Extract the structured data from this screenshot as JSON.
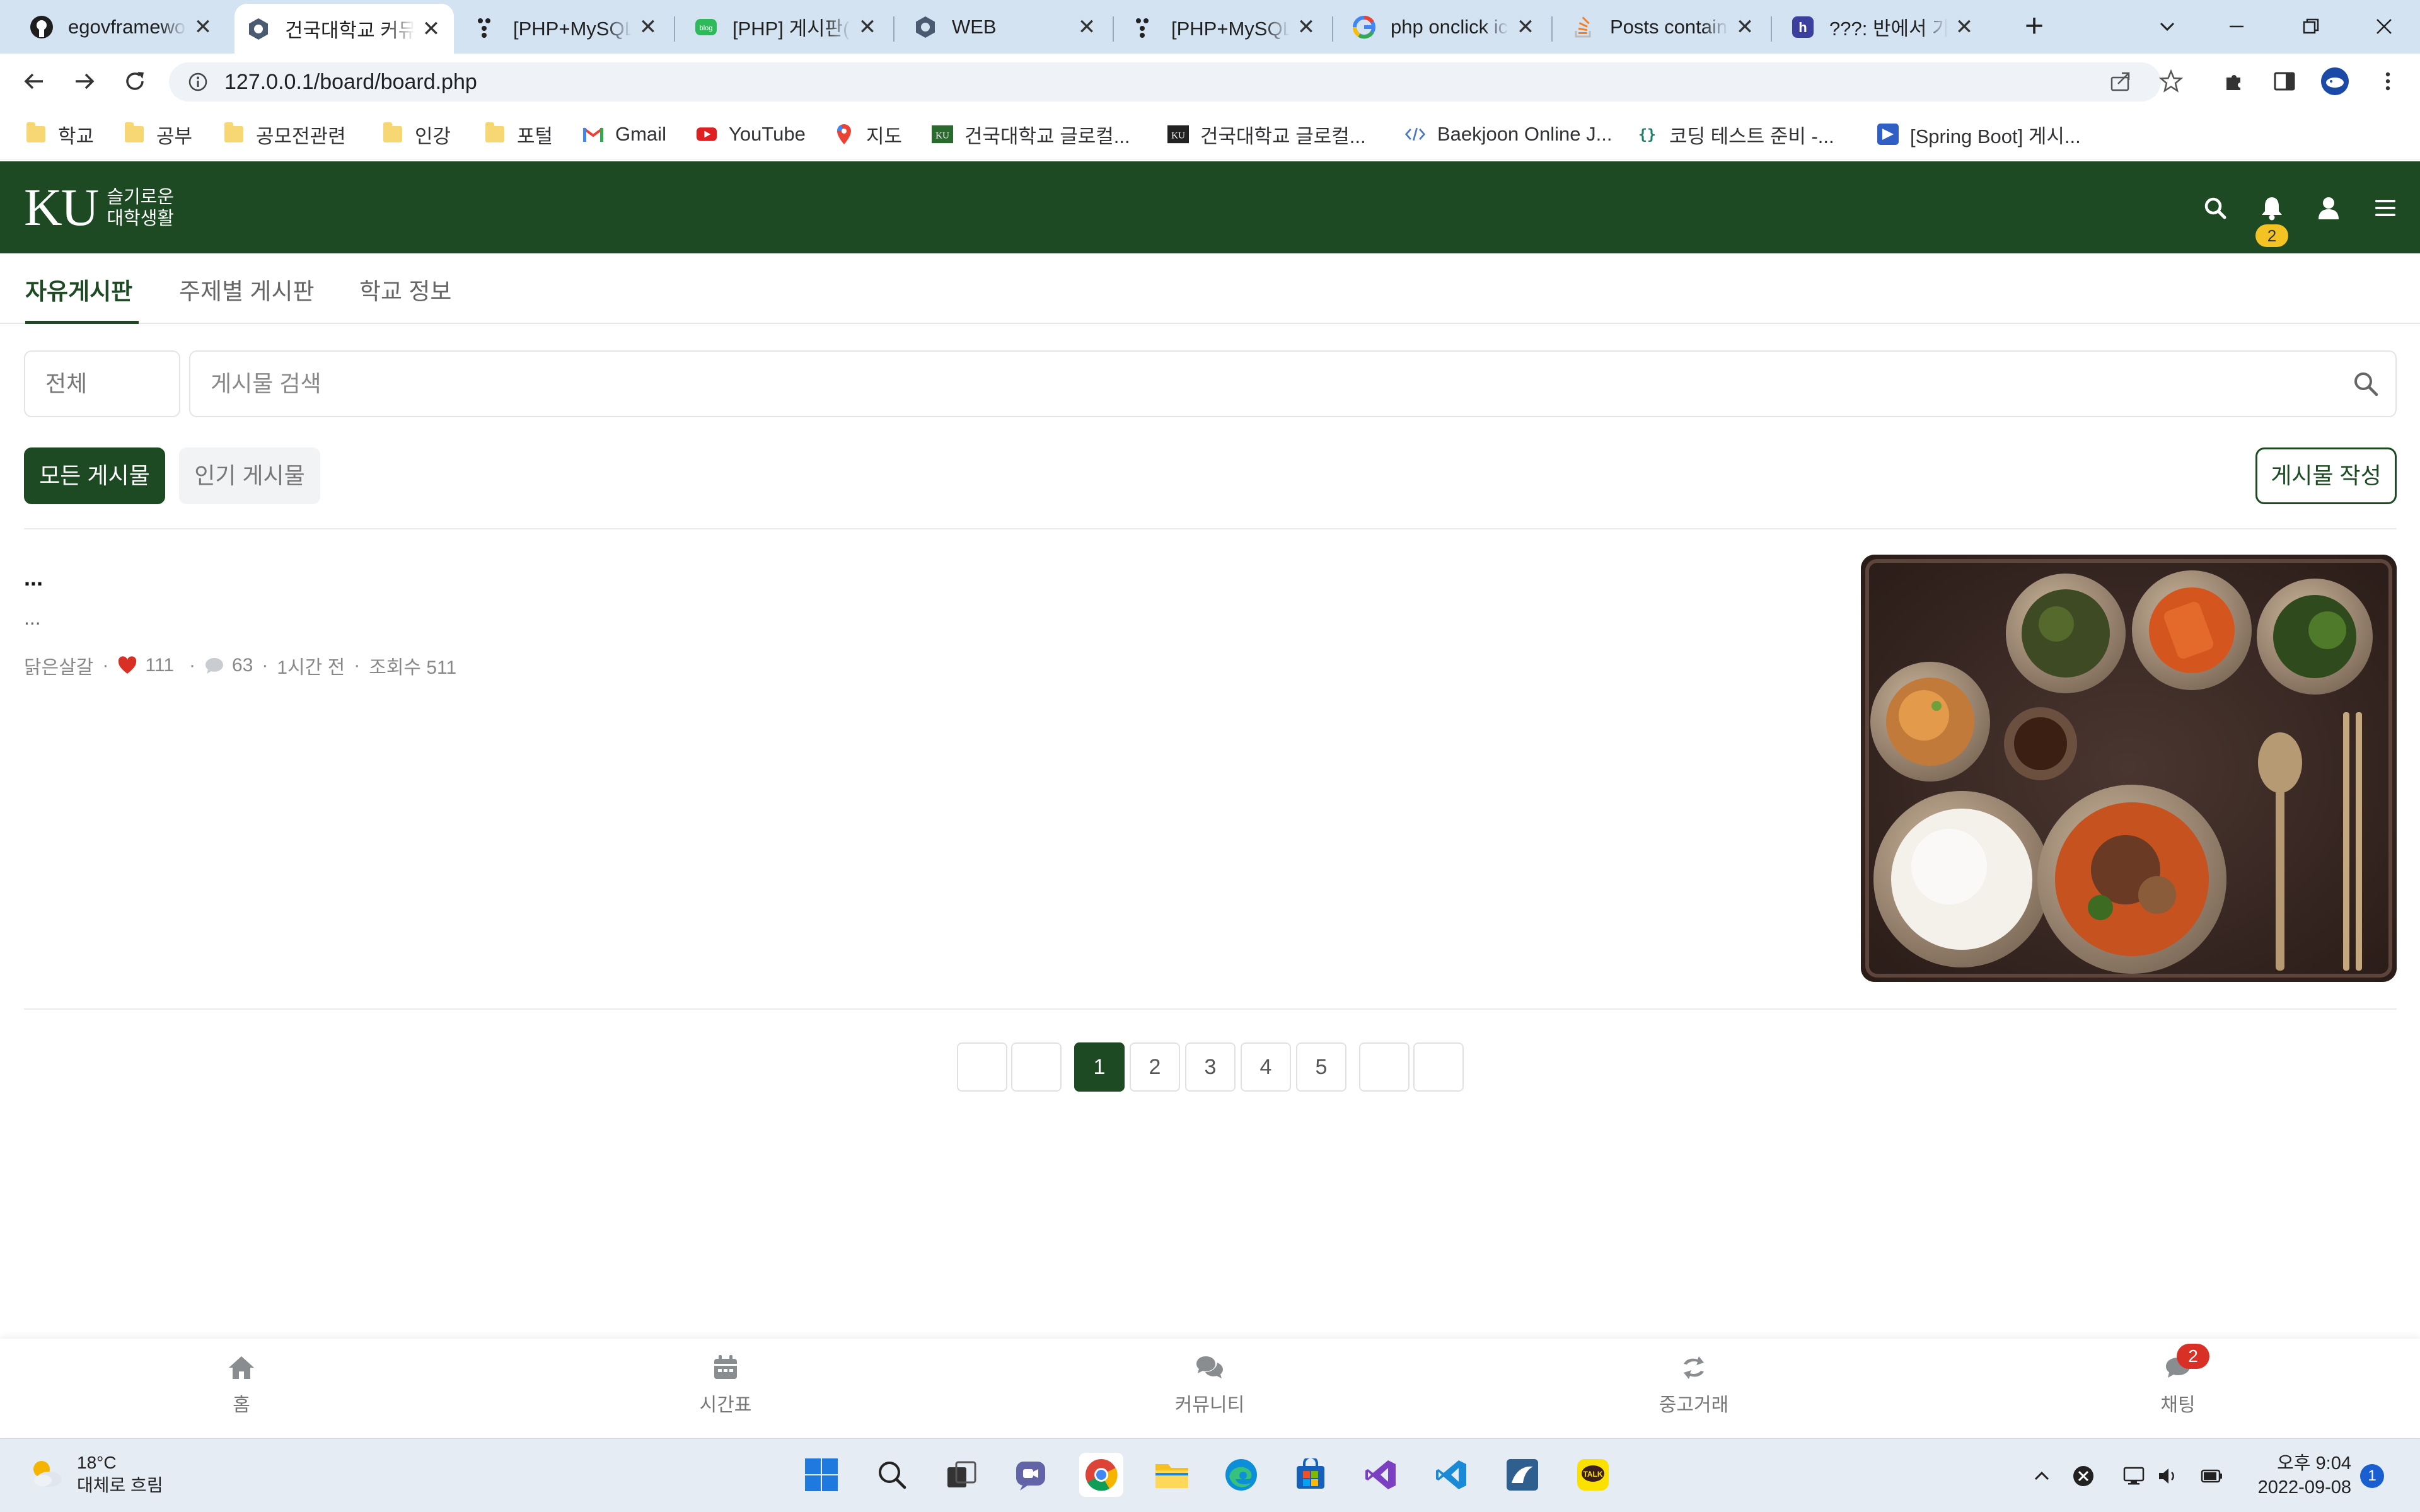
{
  "browser": {
    "tabs": [
      {
        "title": "egovframework",
        "icon": "github-icon",
        "active": false
      },
      {
        "title": "건국대학교 커뮤니티",
        "icon": "hexagon-icon",
        "active": true
      },
      {
        "title": "[PHP+MySQL] 게시판",
        "icon": "dots-icon",
        "active": false
      },
      {
        "title": "[PHP] 게시판(페이징)",
        "icon": "blog-icon",
        "active": false
      },
      {
        "title": "WEB",
        "icon": "hexagon-icon",
        "active": false
      },
      {
        "title": "[PHP+MySQL] 게시판",
        "icon": "dots-icon",
        "active": false
      },
      {
        "title": "php onclick icon",
        "icon": "google-icon",
        "active": false
      },
      {
        "title": "Posts containing",
        "icon": "stackoverflow-icon",
        "active": false
      },
      {
        "title": "???: 반에서 가장",
        "icon": "app-icon",
        "active": false
      }
    ],
    "url": "127.0.0.1/board/board.php",
    "bookmarks": [
      {
        "label": "학교",
        "icon": "folder-icon"
      },
      {
        "label": "공부",
        "icon": "folder-icon"
      },
      {
        "label": "공모전관련",
        "icon": "folder-icon"
      },
      {
        "label": "인강",
        "icon": "folder-icon"
      },
      {
        "label": "포털",
        "icon": "folder-icon"
      },
      {
        "label": "Gmail",
        "icon": "gmail-icon"
      },
      {
        "label": "YouTube",
        "icon": "youtube-icon"
      },
      {
        "label": "지도",
        "icon": "maps-icon"
      },
      {
        "label": "건국대학교 글로컬...",
        "icon": "ku-icon"
      },
      {
        "label": "건국대학교 글로컬...",
        "icon": "ku-icon"
      },
      {
        "label": "Baekjoon Online J...",
        "icon": "code-icon"
      },
      {
        "label": "코딩 테스트 준비 -...",
        "icon": "braces-icon"
      },
      {
        "label": "[Spring Boot] 게시...",
        "icon": "velog-icon"
      }
    ]
  },
  "app": {
    "logo_main": "KU",
    "logo_sub_line1": "슬기로운",
    "logo_sub_line2": "대학생활",
    "notification_count": "2",
    "subnav": [
      "자유게시판",
      "주제별 게시판",
      "학교 정보"
    ],
    "search_scope": "전체",
    "search_placeholder": "게시물 검색",
    "filter_all": "모든 게시물",
    "filter_popular": "인기 게시물",
    "write_button": "게시물 작성",
    "post": {
      "title": "...",
      "body": "...",
      "author": "닭은살갈",
      "likes": "111",
      "comments": "63",
      "time": "1시간 전",
      "views": "조회수 511"
    },
    "pagination": [
      "",
      "",
      "1",
      "2",
      "3",
      "4",
      "5",
      "",
      ""
    ],
    "current_page": "1",
    "bottom_nav": [
      "홈",
      "시간표",
      "커뮤니티",
      "중고거래",
      "채팅"
    ],
    "chat_badge": "2"
  },
  "taskbar": {
    "temperature": "18°C",
    "weather": "대체로 흐림",
    "time": "오후 9:04",
    "date": "2022-09-08",
    "notification_count": "1"
  },
  "colors": {
    "brand_green": "#1d4a23",
    "badge_yellow": "#f3c324",
    "heart_red": "#d93025"
  }
}
